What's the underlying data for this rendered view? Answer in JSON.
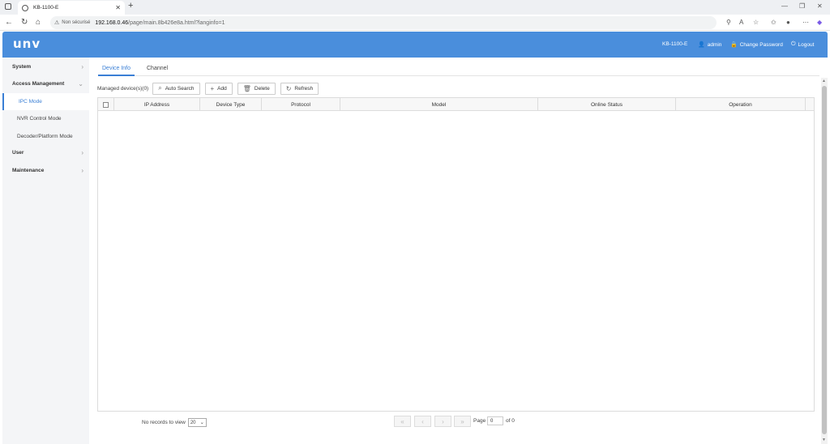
{
  "browser": {
    "tab_title": "KB-1100-E",
    "tab_close": "✕",
    "new_tab": "+",
    "not_secure": "Non sécurisé",
    "url_host": "192.168.0.46",
    "url_path": "/page/main.8b426e8a.html?langinfo=1"
  },
  "header": {
    "logo": "unv",
    "device": "KB-1100-E",
    "user": "admin",
    "change_password": "Change Password",
    "logout": "Logout"
  },
  "menu": {
    "system": "System",
    "access_management": "Access Management",
    "ipc_mode": "IPC Mode",
    "nvr_control_mode": "NVR Control Mode",
    "decoder_platform_mode": "Decoder/Platform Mode",
    "user": "User",
    "maintenance": "Maintenance"
  },
  "tabs": {
    "device_info": "Device Info",
    "channel": "Channel"
  },
  "toolbar": {
    "managed": "Managed device(s)(0)",
    "auto_search": "Auto Search",
    "add": "Add",
    "delete": "Delete",
    "refresh": "Refresh"
  },
  "table": {
    "columns": [
      "IP Address",
      "Device Type",
      "Protocol",
      "Model",
      "Online Status",
      "Operation"
    ]
  },
  "footer": {
    "no_records": "No records to view",
    "page_size": "20",
    "page_label": "Page",
    "page_value": "0",
    "of_label": "of 0"
  },
  "colors": {
    "header_bg": "#4a8edc",
    "accent": "#3a7fd5"
  }
}
